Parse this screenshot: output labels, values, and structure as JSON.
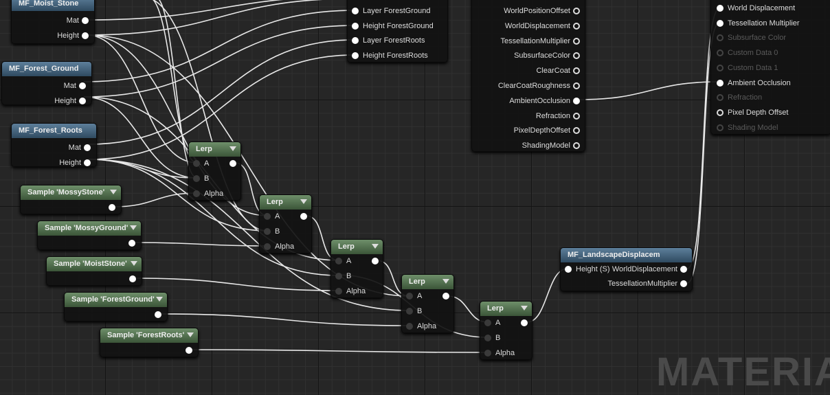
{
  "functions": [
    {
      "title": "MF_Moist_Stone",
      "pins": [
        "Mat",
        "Height"
      ]
    },
    {
      "title": "MF_Forest_Ground",
      "pins": [
        "Mat",
        "Height"
      ]
    },
    {
      "title": "MF_Forest_Roots",
      "pins": [
        "Mat",
        "Height"
      ]
    }
  ],
  "lerps": [
    {
      "title": "Lerp",
      "pins": [
        "A",
        "B",
        "Alpha"
      ]
    }
  ],
  "samples": [
    "Sample 'MossyStone'",
    "Sample 'MossyGround'",
    "Sample 'MoistStone'",
    "Sample 'ForestGround'",
    "Sample 'ForestRoots'"
  ],
  "layer_blend": {
    "pins": [
      "Layer ForestGround",
      "Height ForestGround",
      "Layer ForestRoots",
      "Height ForestRoots"
    ]
  },
  "attributes": {
    "pins": [
      "WorldPositionOffset",
      "WorldDisplacement",
      "TessellationMultiplier",
      "SubsurfaceColor",
      "ClearCoat",
      "ClearCoatRoughness",
      "AmbientOcclusion",
      "Refraction",
      "PixelDepthOffset",
      "ShadingModel"
    ]
  },
  "result": {
    "pins": [
      {
        "label": "World Displacement",
        "state": "connected"
      },
      {
        "label": "Tessellation Multiplier",
        "state": "connected"
      },
      {
        "label": "Subsurface Color",
        "state": "disabled"
      },
      {
        "label": "Custom Data 0",
        "state": "disabled"
      },
      {
        "label": "Custom Data 1",
        "state": "disabled"
      },
      {
        "label": "Ambient Occlusion",
        "state": "connected"
      },
      {
        "label": "Refraction",
        "state": "disabled"
      },
      {
        "label": "Pixel Depth Offset",
        "state": "enabled"
      },
      {
        "label": "Shading Model",
        "state": "disabled"
      }
    ]
  },
  "displacement": {
    "title": "MF_LandscapeDisplacem",
    "input": "Height (S)",
    "outputs": [
      "WorldDisplacement",
      "TessellationMultiplier"
    ]
  },
  "watermark": "MATERIAL",
  "colors": {
    "function_header": "#4a6a85",
    "lerp_header": "#5a7a56",
    "wire": "#e8e8e8",
    "background": "#262626"
  }
}
